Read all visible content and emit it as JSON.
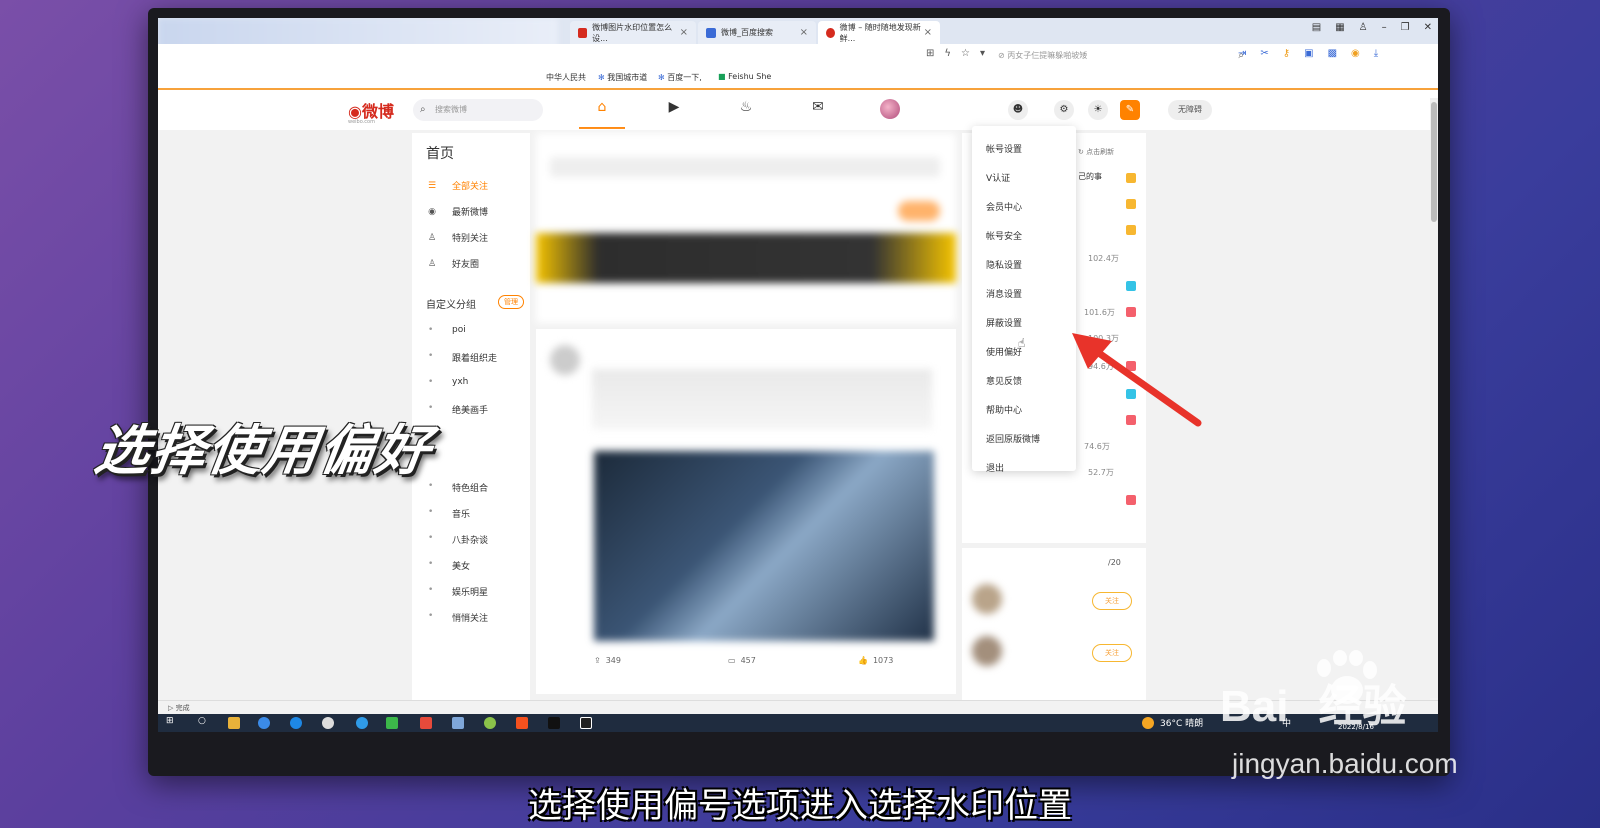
{
  "browser": {
    "tabs": [
      {
        "label": "微博图片水印位置怎么设..."
      },
      {
        "label": "微博_百度搜索"
      },
      {
        "label": "微博 – 随时随地发现新鲜..."
      }
    ],
    "address_placeholder": "丙女子仨提嘛躲啪坡矮",
    "bookmarks": [
      "中华人民共",
      "我国城市道",
      "百度一下,",
      "Feishu She"
    ]
  },
  "weibo": {
    "logo_text": "微博",
    "logo_sub": "weibo.com",
    "search_placeholder": "搜索微博",
    "header_pill": "无障碍",
    "left_nav": {
      "title": "首页",
      "items": [
        "全部关注",
        "最新微博",
        "特别关注",
        "好友圈"
      ],
      "section": "自定义分组",
      "manage": "管理",
      "groups": [
        "poi",
        "跟着组织走",
        "yxh",
        "绝美画手",
        "特色组合",
        "音乐",
        "八卦杂谈",
        "美女",
        "娱乐明星",
        "悄悄关注"
      ]
    },
    "feed_stats": {
      "repost": "349",
      "comment": "457",
      "like": "1073"
    },
    "right_col": {
      "refresh": "点击刷新",
      "snippet": "己的事",
      "numbers": [
        "102.4万",
        "101.6万",
        "100.3万",
        "94.6万",
        "74.6万",
        "52.7万"
      ],
      "page": "/20",
      "follow": "关注"
    },
    "settings_menu": [
      "帐号设置",
      "V认证",
      "会员中心",
      "帐号安全",
      "隐私设置",
      "消息设置",
      "屏蔽设置",
      "使用偏好",
      "意见反馈",
      "帮助中心",
      "返回原版微博",
      "退出"
    ]
  },
  "statusbar": {
    "text": "完成"
  },
  "taskbar": {
    "weather": "36°C 晴朗",
    "ime": "中",
    "date": "2022/8/16"
  },
  "overlay": {
    "caption": "选择使用偏好",
    "subtitle": "选择使用偏号选项进入选择水印位置",
    "watermark_brand": "Bai",
    "watermark_brand2": "经验",
    "watermark_url": "jingyan.baidu.com"
  },
  "colors": {
    "accent": "#ff8200",
    "arrow": "#e8332a"
  }
}
